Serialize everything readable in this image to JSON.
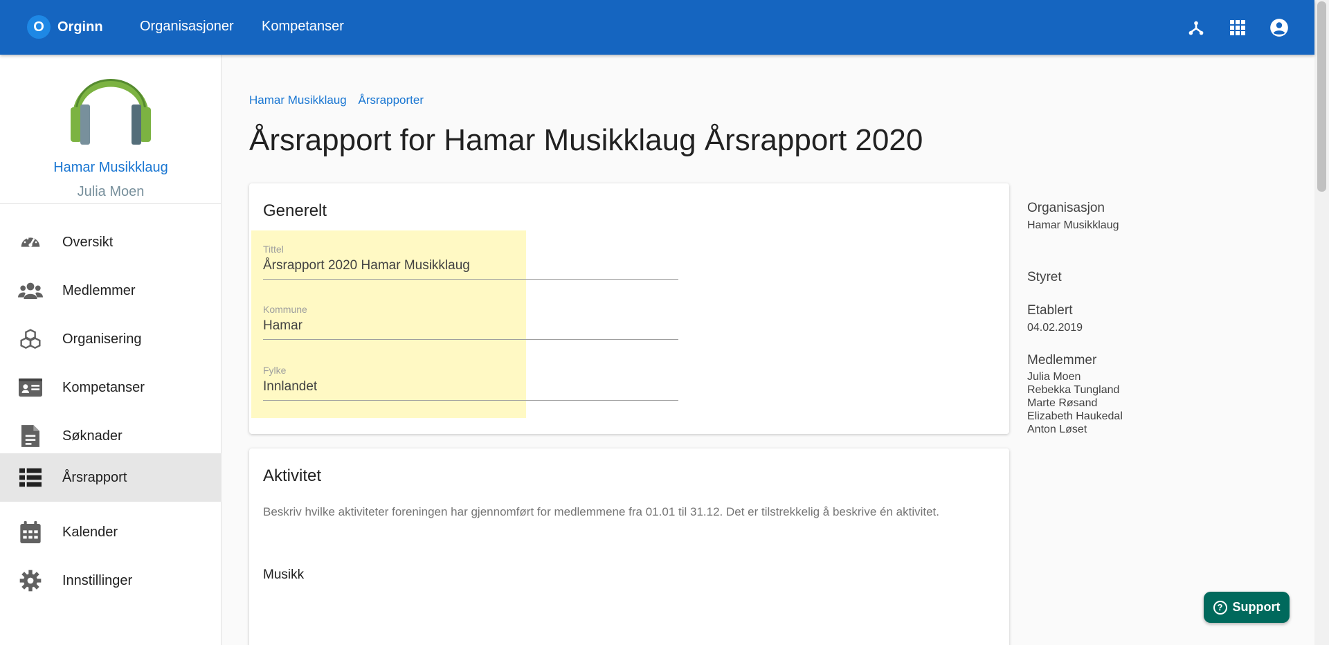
{
  "topbar": {
    "brand_letter": "O",
    "brand_name": "Orginn",
    "nav": [
      "Organisasjoner",
      "Kompetanser"
    ],
    "icons": [
      "org-tree-icon",
      "apps-grid-icon",
      "account-circle-icon"
    ]
  },
  "sidebar": {
    "org_name": "Hamar Musikklaug",
    "user_name": "Julia Moen",
    "items": [
      {
        "label": "Oversikt",
        "icon": "dashboard-gauge-icon"
      },
      {
        "label": "Medlemmer",
        "icon": "people-group-icon"
      },
      {
        "label": "Organisering",
        "icon": "cubes-icon"
      },
      {
        "label": "Kompetanser",
        "icon": "id-card-icon"
      },
      {
        "label": "Søknader",
        "icon": "document-icon"
      },
      {
        "label": "Årsrapport",
        "icon": "table-list-icon",
        "active": true
      },
      {
        "label": "Kalender",
        "icon": "calendar-icon"
      },
      {
        "label": "Innstillinger",
        "icon": "gear-icon"
      }
    ]
  },
  "breadcrumb": [
    "Hamar Musikklaug",
    "Årsrapporter"
  ],
  "page_title": "Årsrapport for Hamar Musikklaug Årsrapport 2020",
  "generelt": {
    "title": "Generelt",
    "fields": [
      {
        "label": "Tittel",
        "value": "Årsrapport 2020 Hamar Musikklaug"
      },
      {
        "label": "Kommune",
        "value": "Hamar"
      },
      {
        "label": "Fylke",
        "value": "Innlandet"
      }
    ]
  },
  "aktivitet": {
    "title": "Aktivitet",
    "description": "Beskriv hvilke aktiviteter foreningen har gjennomført for medlemmene fra 01.01 til 31.12. Det er tilstrekkelig å beskrive én aktivitet.",
    "item": "Musikk"
  },
  "info": {
    "org_label": "Organisasjon",
    "org_value": "Hamar Musikklaug",
    "styret_label": "Styret",
    "etablert_label": "Etablert",
    "etablert_value": "04.02.2019",
    "medlemmer_label": "Medlemmer",
    "medlemmer": [
      "Julia Moen",
      "Rebekka Tungland",
      "Marte Røsand",
      "Elizabeth Haukedal",
      "Anton Løset"
    ]
  },
  "support": {
    "label": "Support",
    "icon_glyph": "?"
  },
  "colors": {
    "primary": "#1565c0",
    "link": "#1976d2",
    "highlight": "#fff9c4",
    "support": "#00695c"
  }
}
